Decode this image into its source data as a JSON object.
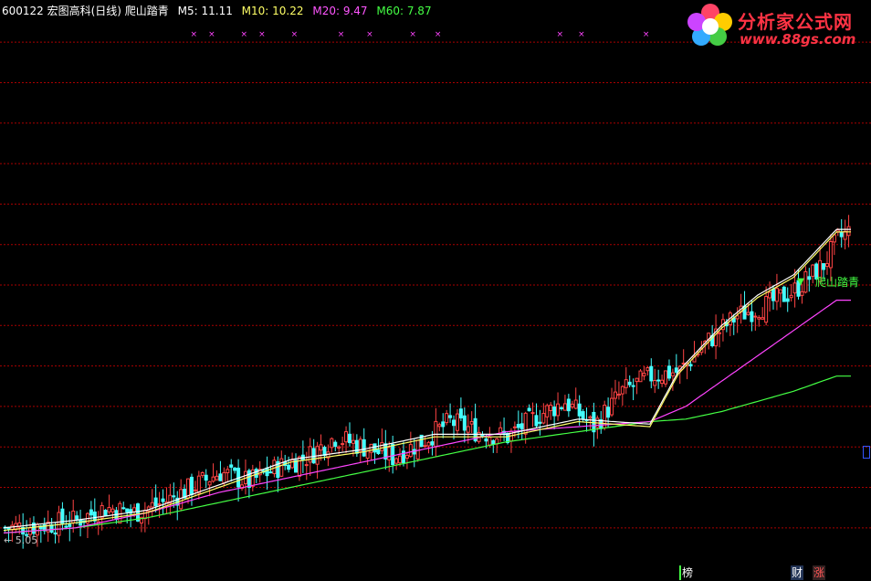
{
  "header": {
    "code_title": "600122 宏图高科(日线) 爬山踏青",
    "m5": "M5: 11.11",
    "m10": "M10: 10.22",
    "m20": "M20: 9.47",
    "m60": "M60: 7.87"
  },
  "logo": {
    "name": "分析家公式网",
    "url": "www.88gs.com"
  },
  "labels": {
    "low_price": "← 5.05",
    "signal_name": "爬山踏青"
  },
  "bottom_buttons": {
    "b1": "榜",
    "b2": "财",
    "b3": "涨"
  },
  "colors": {
    "background": "#000000",
    "grid": "#aa0000",
    "up": "#ff4444",
    "down": "#44ffff",
    "m5": "#ffffff",
    "m10": "#ffff66",
    "m20": "#ff44ff",
    "m60": "#44ff44",
    "marker": "#ff44ff"
  },
  "chart_data": {
    "type": "candlestick",
    "x_count": 236,
    "ylim": [
      4.8,
      15.2
    ],
    "grid_y": [
      14.8,
      14.0,
      13.2,
      12.4,
      11.6,
      10.8,
      10.0,
      9.2,
      8.4,
      7.6,
      6.8,
      6.0,
      5.2
    ],
    "close_series": [
      [
        0,
        5.2
      ],
      [
        10,
        5.25
      ],
      [
        20,
        5.35
      ],
      [
        28,
        5.6
      ],
      [
        36,
        5.5
      ],
      [
        44,
        5.7
      ],
      [
        52,
        6.0
      ],
      [
        60,
        6.3
      ],
      [
        68,
        6.1
      ],
      [
        76,
        6.4
      ],
      [
        84,
        6.6
      ],
      [
        92,
        7.0
      ],
      [
        100,
        6.8
      ],
      [
        108,
        6.6
      ],
      [
        116,
        6.9
      ],
      [
        124,
        7.3
      ],
      [
        132,
        7.1
      ],
      [
        140,
        7.0
      ],
      [
        148,
        7.4
      ],
      [
        156,
        7.7
      ],
      [
        164,
        7.2
      ],
      [
        172,
        7.9
      ],
      [
        180,
        8.2
      ],
      [
        188,
        8.3
      ],
      [
        196,
        8.9
      ],
      [
        204,
        9.4
      ],
      [
        212,
        9.6
      ],
      [
        220,
        9.9
      ],
      [
        228,
        10.4
      ],
      [
        232,
        10.9
      ],
      [
        236,
        11.1
      ]
    ],
    "ma20": [
      [
        0,
        5.1
      ],
      [
        20,
        5.2
      ],
      [
        40,
        5.5
      ],
      [
        60,
        5.9
      ],
      [
        80,
        6.2
      ],
      [
        100,
        6.5
      ],
      [
        120,
        6.8
      ],
      [
        140,
        7.1
      ],
      [
        160,
        7.2
      ],
      [
        180,
        7.3
      ],
      [
        190,
        7.6
      ],
      [
        200,
        8.1
      ],
      [
        210,
        8.6
      ],
      [
        220,
        9.1
      ],
      [
        232,
        9.7
      ]
    ],
    "ma60": [
      [
        0,
        5.1
      ],
      [
        20,
        5.2
      ],
      [
        40,
        5.4
      ],
      [
        60,
        5.7
      ],
      [
        80,
        6.0
      ],
      [
        100,
        6.3
      ],
      [
        120,
        6.6
      ],
      [
        140,
        6.9
      ],
      [
        160,
        7.1
      ],
      [
        180,
        7.3
      ],
      [
        190,
        7.35
      ],
      [
        200,
        7.5
      ],
      [
        210,
        7.7
      ],
      [
        220,
        7.9
      ],
      [
        232,
        8.2
      ]
    ],
    "ma5": [
      [
        0,
        5.2
      ],
      [
        20,
        5.35
      ],
      [
        40,
        5.55
      ],
      [
        60,
        6.05
      ],
      [
        80,
        6.55
      ],
      [
        100,
        6.75
      ],
      [
        120,
        7.05
      ],
      [
        140,
        7.05
      ],
      [
        160,
        7.35
      ],
      [
        180,
        7.25
      ],
      [
        188,
        8.3
      ],
      [
        200,
        9.2
      ],
      [
        210,
        9.8
      ],
      [
        220,
        10.2
      ],
      [
        232,
        11.1
      ]
    ],
    "signal_points": [
      52,
      57,
      66,
      71,
      80,
      93,
      101,
      113,
      120,
      154,
      160,
      178
    ],
    "signal_index": 222,
    "low_price": 5.05
  }
}
